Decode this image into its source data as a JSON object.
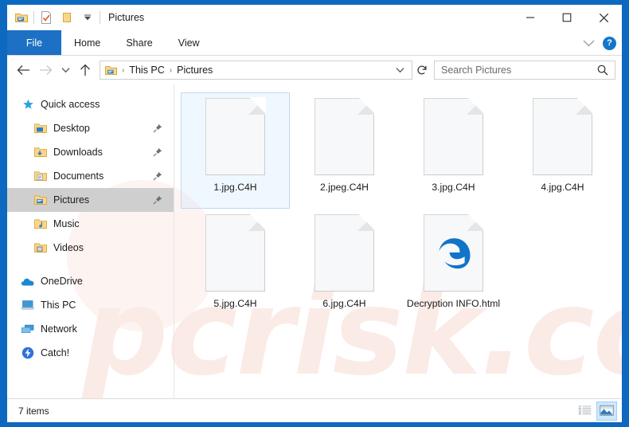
{
  "window": {
    "title": "Pictures",
    "border_color": "#0d68c0",
    "quick_access_toolbar": [
      {
        "name": "folder-properties-icon",
        "label": "Folder"
      },
      {
        "name": "properties-icon",
        "label": "Properties"
      },
      {
        "name": "new-folder-icon",
        "label": "New folder"
      },
      {
        "name": "customize-chevron-icon",
        "label": "Customize Quick Access Toolbar"
      }
    ],
    "controls": {
      "minimize": "—",
      "maximize": "□",
      "close": "✕"
    }
  },
  "ribbon": {
    "tabs": [
      {
        "label": "File",
        "active": true
      },
      {
        "label": "Home",
        "active": false
      },
      {
        "label": "Share",
        "active": false
      },
      {
        "label": "View",
        "active": false
      }
    ],
    "collapse_label": "⌄",
    "help_label": "?",
    "file_tab_color": "#1d70c4"
  },
  "navbar": {
    "back_label": "←",
    "forward_label": "→",
    "recent_label": "⌄",
    "up_label": "↑",
    "breadcrumbs": [
      "This PC",
      "Pictures"
    ],
    "breadcrumb_separator": "›",
    "address_chevron": "⌄",
    "refresh_label": "↻",
    "search_placeholder": "Search Pictures",
    "search_value": ""
  },
  "sidebar": {
    "groups": [
      {
        "header": {
          "label": "Quick access",
          "icon": "star-pin-icon"
        },
        "items": [
          {
            "label": "Desktop",
            "icon": "desktop-folder-icon",
            "pinned": true,
            "selected": false
          },
          {
            "label": "Downloads",
            "icon": "downloads-folder-icon",
            "pinned": true,
            "selected": false
          },
          {
            "label": "Documents",
            "icon": "documents-folder-icon",
            "pinned": true,
            "selected": false
          },
          {
            "label": "Pictures",
            "icon": "pictures-folder-icon",
            "pinned": true,
            "selected": true
          },
          {
            "label": "Music",
            "icon": "music-folder-icon",
            "pinned": false,
            "selected": false
          },
          {
            "label": "Videos",
            "icon": "videos-folder-icon",
            "pinned": false,
            "selected": false
          }
        ]
      },
      {
        "header": null,
        "items": [
          {
            "label": "OneDrive",
            "icon": "onedrive-cloud-icon",
            "pinned": false,
            "selected": false
          },
          {
            "label": "This PC",
            "icon": "this-pc-icon",
            "pinned": false,
            "selected": false
          },
          {
            "label": "Network",
            "icon": "network-icon",
            "pinned": false,
            "selected": false
          },
          {
            "label": "Catch!",
            "icon": "catch-bolt-icon",
            "pinned": false,
            "selected": false
          }
        ]
      }
    ]
  },
  "files": [
    {
      "name": "1.jpg.C4H",
      "icon": "blank-file-icon",
      "selected": true
    },
    {
      "name": "2.jpeg.C4H",
      "icon": "blank-file-icon",
      "selected": false
    },
    {
      "name": "3.jpg.C4H",
      "icon": "blank-file-icon",
      "selected": false
    },
    {
      "name": "4.jpg.C4H",
      "icon": "blank-file-icon",
      "selected": false
    },
    {
      "name": "5.jpg.C4H",
      "icon": "blank-file-icon",
      "selected": false
    },
    {
      "name": "6.jpg.C4H",
      "icon": "blank-file-icon",
      "selected": false
    },
    {
      "name": "Decryption INFO.html",
      "icon": "edge-browser-icon",
      "selected": false
    }
  ],
  "statusbar": {
    "item_count": "7 items",
    "views": [
      {
        "name": "details-view-button",
        "active": false
      },
      {
        "name": "large-icons-view-button",
        "active": true
      }
    ]
  },
  "watermark": {
    "text": "pcrisk.com",
    "color": "#fbebe6"
  }
}
